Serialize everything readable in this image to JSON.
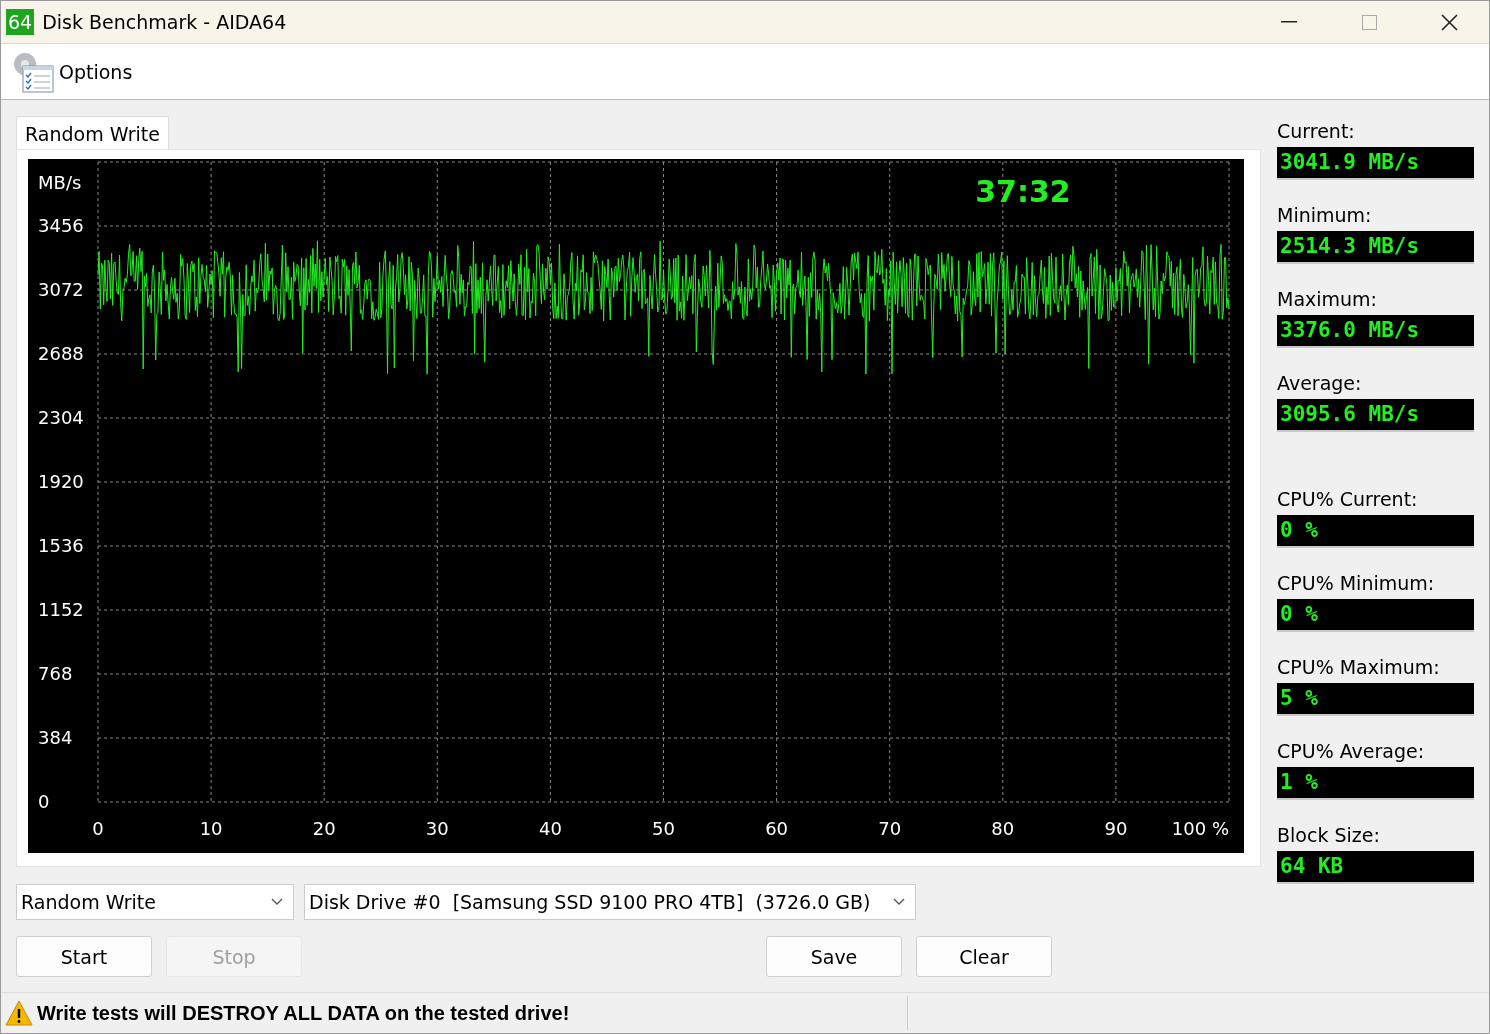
{
  "window": {
    "title": "Disk Benchmark - AIDA64",
    "badge": "64"
  },
  "toolbar": {
    "options": "Options"
  },
  "tabs": [
    {
      "label": "Random Write",
      "selected": true
    }
  ],
  "graph": {
    "unit": "MB/s",
    "timer": "37:32",
    "y_labels": [
      "3456",
      "3072",
      "2688",
      "2304",
      "1920",
      "1536",
      "1152",
      "768",
      "384",
      "0"
    ],
    "x_labels": [
      "0",
      "10",
      "20",
      "30",
      "40",
      "50",
      "60",
      "70",
      "80",
      "90",
      "100 %"
    ]
  },
  "speed_stats": [
    {
      "label": "Current:",
      "value": "3041.9 MB/s"
    },
    {
      "label": "Minimum:",
      "value": "2514.3 MB/s"
    },
    {
      "label": "Maximum:",
      "value": "3376.0 MB/s"
    },
    {
      "label": "Average:",
      "value": "3095.6 MB/s"
    }
  ],
  "cpu_stats": [
    {
      "label": "CPU% Current:",
      "value": "0 %"
    },
    {
      "label": "CPU% Minimum:",
      "value": "0 %"
    },
    {
      "label": "CPU% Maximum:",
      "value": "5 %"
    },
    {
      "label": "CPU% Average:",
      "value": "1 %"
    }
  ],
  "block_size": {
    "label": "Block Size:",
    "value": "64 KB"
  },
  "test_select": {
    "value": "Random Write"
  },
  "drive_select": {
    "value": "Disk Drive #0  [Samsung SSD 9100 PRO 4TB]  (3726.0 GB)"
  },
  "buttons": [
    {
      "label": "Start",
      "disabled": false
    },
    {
      "label": "Stop",
      "disabled": true
    },
    {
      "label": "Save",
      "disabled": false
    },
    {
      "label": "Clear",
      "disabled": false
    }
  ],
  "status_bar": {
    "message": "Write tests will DESTROY ALL DATA on the tested drive!"
  }
}
